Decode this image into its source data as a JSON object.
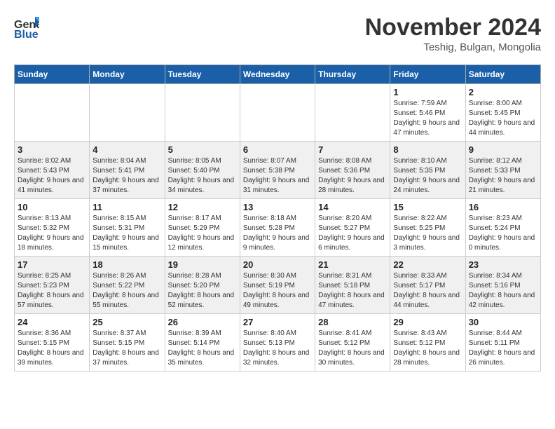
{
  "header": {
    "logo_line1": "General",
    "logo_line2": "Blue",
    "month": "November 2024",
    "location": "Teshig, Bulgan, Mongolia"
  },
  "weekdays": [
    "Sunday",
    "Monday",
    "Tuesday",
    "Wednesday",
    "Thursday",
    "Friday",
    "Saturday"
  ],
  "weeks": [
    [
      {
        "day": "",
        "details": []
      },
      {
        "day": "",
        "details": []
      },
      {
        "day": "",
        "details": []
      },
      {
        "day": "",
        "details": []
      },
      {
        "day": "",
        "details": []
      },
      {
        "day": "1",
        "details": [
          "Sunrise: 7:59 AM",
          "Sunset: 5:46 PM",
          "Daylight: 9 hours and 47 minutes."
        ]
      },
      {
        "day": "2",
        "details": [
          "Sunrise: 8:00 AM",
          "Sunset: 5:45 PM",
          "Daylight: 9 hours and 44 minutes."
        ]
      }
    ],
    [
      {
        "day": "3",
        "details": [
          "Sunrise: 8:02 AM",
          "Sunset: 5:43 PM",
          "Daylight: 9 hours and 41 minutes."
        ]
      },
      {
        "day": "4",
        "details": [
          "Sunrise: 8:04 AM",
          "Sunset: 5:41 PM",
          "Daylight: 9 hours and 37 minutes."
        ]
      },
      {
        "day": "5",
        "details": [
          "Sunrise: 8:05 AM",
          "Sunset: 5:40 PM",
          "Daylight: 9 hours and 34 minutes."
        ]
      },
      {
        "day": "6",
        "details": [
          "Sunrise: 8:07 AM",
          "Sunset: 5:38 PM",
          "Daylight: 9 hours and 31 minutes."
        ]
      },
      {
        "day": "7",
        "details": [
          "Sunrise: 8:08 AM",
          "Sunset: 5:36 PM",
          "Daylight: 9 hours and 28 minutes."
        ]
      },
      {
        "day": "8",
        "details": [
          "Sunrise: 8:10 AM",
          "Sunset: 5:35 PM",
          "Daylight: 9 hours and 24 minutes."
        ]
      },
      {
        "day": "9",
        "details": [
          "Sunrise: 8:12 AM",
          "Sunset: 5:33 PM",
          "Daylight: 9 hours and 21 minutes."
        ]
      }
    ],
    [
      {
        "day": "10",
        "details": [
          "Sunrise: 8:13 AM",
          "Sunset: 5:32 PM",
          "Daylight: 9 hours and 18 minutes."
        ]
      },
      {
        "day": "11",
        "details": [
          "Sunrise: 8:15 AM",
          "Sunset: 5:31 PM",
          "Daylight: 9 hours and 15 minutes."
        ]
      },
      {
        "day": "12",
        "details": [
          "Sunrise: 8:17 AM",
          "Sunset: 5:29 PM",
          "Daylight: 9 hours and 12 minutes."
        ]
      },
      {
        "day": "13",
        "details": [
          "Sunrise: 8:18 AM",
          "Sunset: 5:28 PM",
          "Daylight: 9 hours and 9 minutes."
        ]
      },
      {
        "day": "14",
        "details": [
          "Sunrise: 8:20 AM",
          "Sunset: 5:27 PM",
          "Daylight: 9 hours and 6 minutes."
        ]
      },
      {
        "day": "15",
        "details": [
          "Sunrise: 8:22 AM",
          "Sunset: 5:25 PM",
          "Daylight: 9 hours and 3 minutes."
        ]
      },
      {
        "day": "16",
        "details": [
          "Sunrise: 8:23 AM",
          "Sunset: 5:24 PM",
          "Daylight: 9 hours and 0 minutes."
        ]
      }
    ],
    [
      {
        "day": "17",
        "details": [
          "Sunrise: 8:25 AM",
          "Sunset: 5:23 PM",
          "Daylight: 8 hours and 57 minutes."
        ]
      },
      {
        "day": "18",
        "details": [
          "Sunrise: 8:26 AM",
          "Sunset: 5:22 PM",
          "Daylight: 8 hours and 55 minutes."
        ]
      },
      {
        "day": "19",
        "details": [
          "Sunrise: 8:28 AM",
          "Sunset: 5:20 PM",
          "Daylight: 8 hours and 52 minutes."
        ]
      },
      {
        "day": "20",
        "details": [
          "Sunrise: 8:30 AM",
          "Sunset: 5:19 PM",
          "Daylight: 8 hours and 49 minutes."
        ]
      },
      {
        "day": "21",
        "details": [
          "Sunrise: 8:31 AM",
          "Sunset: 5:18 PM",
          "Daylight: 8 hours and 47 minutes."
        ]
      },
      {
        "day": "22",
        "details": [
          "Sunrise: 8:33 AM",
          "Sunset: 5:17 PM",
          "Daylight: 8 hours and 44 minutes."
        ]
      },
      {
        "day": "23",
        "details": [
          "Sunrise: 8:34 AM",
          "Sunset: 5:16 PM",
          "Daylight: 8 hours and 42 minutes."
        ]
      }
    ],
    [
      {
        "day": "24",
        "details": [
          "Sunrise: 8:36 AM",
          "Sunset: 5:15 PM",
          "Daylight: 8 hours and 39 minutes."
        ]
      },
      {
        "day": "25",
        "details": [
          "Sunrise: 8:37 AM",
          "Sunset: 5:15 PM",
          "Daylight: 8 hours and 37 minutes."
        ]
      },
      {
        "day": "26",
        "details": [
          "Sunrise: 8:39 AM",
          "Sunset: 5:14 PM",
          "Daylight: 8 hours and 35 minutes."
        ]
      },
      {
        "day": "27",
        "details": [
          "Sunrise: 8:40 AM",
          "Sunset: 5:13 PM",
          "Daylight: 8 hours and 32 minutes."
        ]
      },
      {
        "day": "28",
        "details": [
          "Sunrise: 8:41 AM",
          "Sunset: 5:12 PM",
          "Daylight: 8 hours and 30 minutes."
        ]
      },
      {
        "day": "29",
        "details": [
          "Sunrise: 8:43 AM",
          "Sunset: 5:12 PM",
          "Daylight: 8 hours and 28 minutes."
        ]
      },
      {
        "day": "30",
        "details": [
          "Sunrise: 8:44 AM",
          "Sunset: 5:11 PM",
          "Daylight: 8 hours and 26 minutes."
        ]
      }
    ]
  ]
}
